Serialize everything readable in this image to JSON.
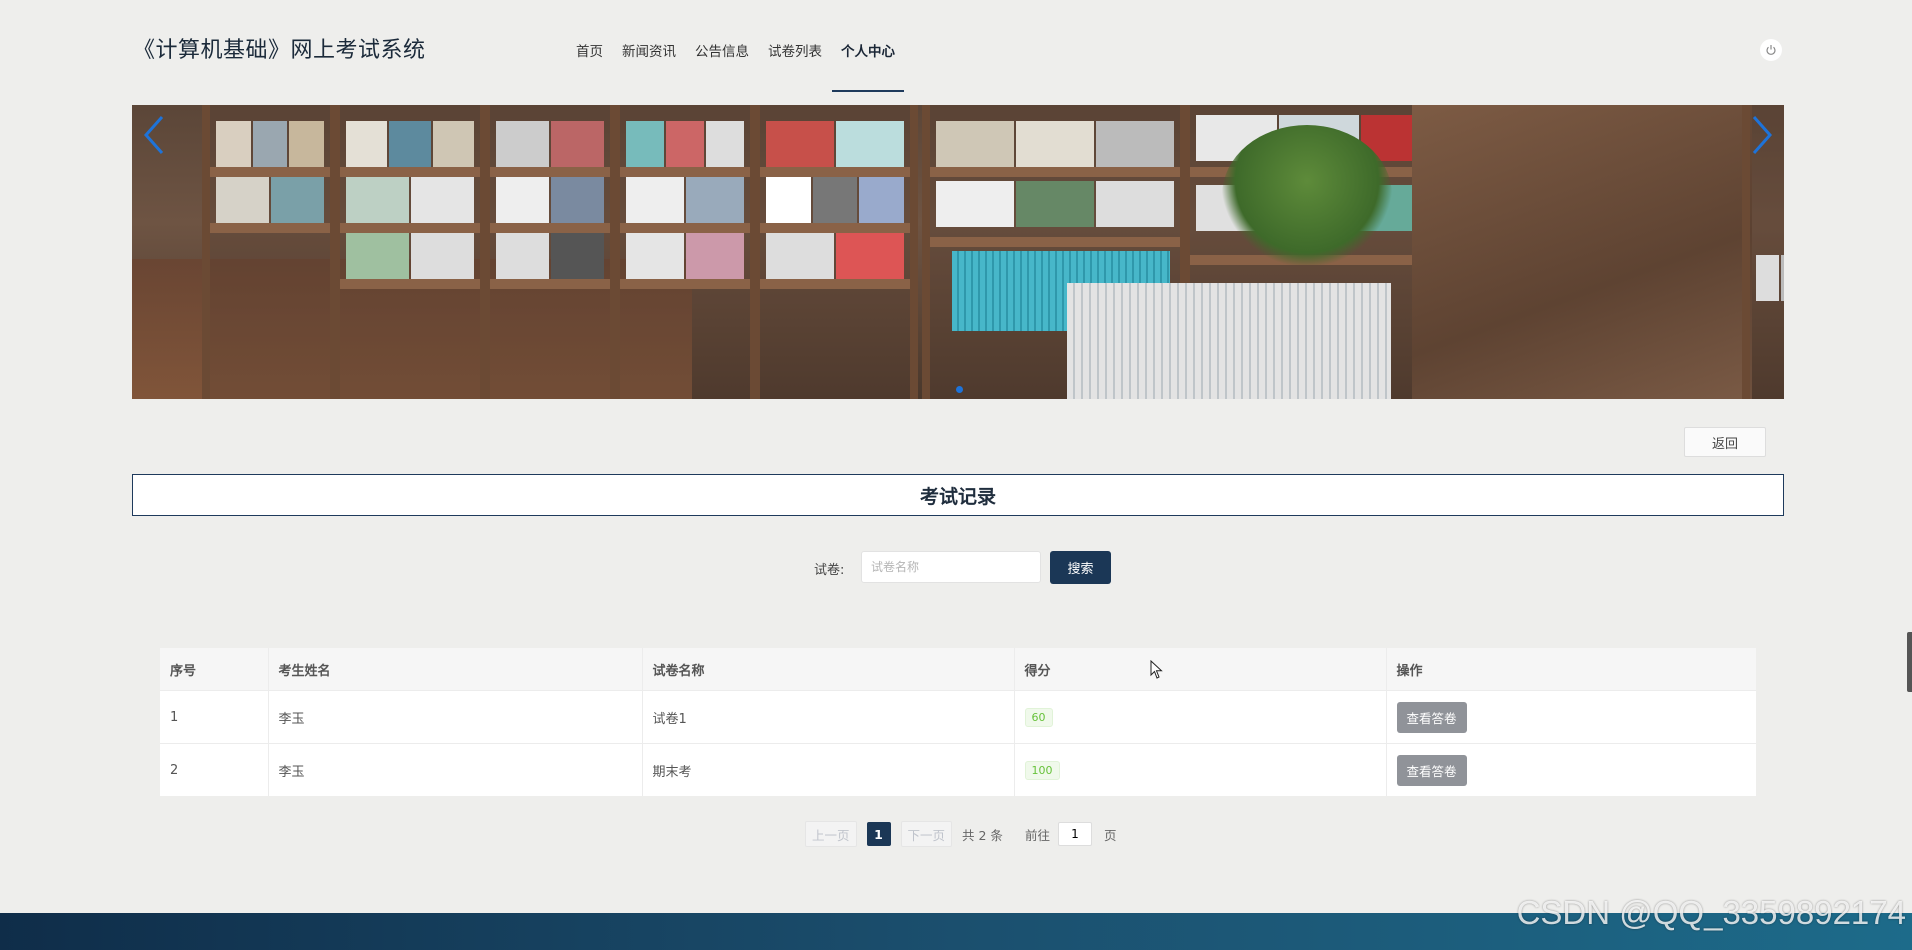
{
  "header": {
    "site_title": "《计算机基础》网上考试系统",
    "nav": [
      "首页",
      "新闻资讯",
      "公告信息",
      "试卷列表",
      "个人中心"
    ],
    "active_nav": "个人中心"
  },
  "banner": {
    "icons": {
      "prev": "chevron-left-icon",
      "next": "chevron-right-icon",
      "power": "power-icon"
    },
    "accent": "#1e73d9"
  },
  "back_button": "返回",
  "section_title": "考试记录",
  "search": {
    "label": "试卷:",
    "placeholder": "试卷名称",
    "value": "",
    "button": "搜索"
  },
  "table": {
    "headers": [
      "序号",
      "考生姓名",
      "试卷名称",
      "得分",
      "操作"
    ],
    "rows": [
      {
        "index": "1",
        "student": "李玉",
        "paper": "试卷1",
        "score": "60",
        "action": "查看答卷"
      },
      {
        "index": "2",
        "student": "李玉",
        "paper": "期末考",
        "score": "100",
        "action": "查看答卷"
      }
    ]
  },
  "pagination": {
    "prev": "上一页",
    "current": "1",
    "next": "下一页",
    "total": "共 2 条",
    "goto": "前往",
    "page_value": "1",
    "page_unit": "页"
  },
  "watermark": "CSDN @QQ_3359892174",
  "colors": {
    "primary": "#1b3756",
    "score": "#67c23a",
    "action_btn": "#909399"
  }
}
